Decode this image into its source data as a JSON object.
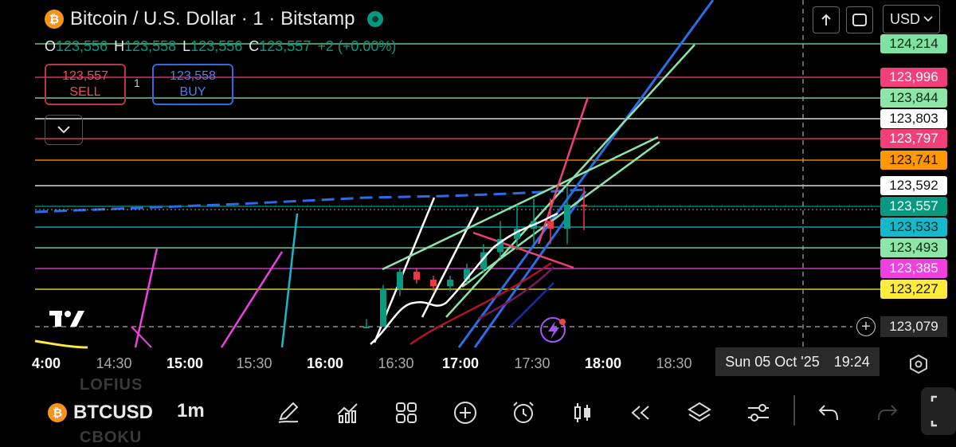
{
  "header": {
    "title": "Bitcoin / U.S. Dollar · 1 · Bitstamp",
    "coin_icon": "bitcoin-icon",
    "coin_glyph": "₿",
    "currency": "USD"
  },
  "ohlc": {
    "o_label": "O",
    "o": "123,556",
    "h_label": "H",
    "h": "123,558",
    "l_label": "L",
    "l": "123,556",
    "c_label": "C",
    "c": "123,557",
    "change": "+2 (+0.00%)"
  },
  "trade": {
    "sell_price": "123,557",
    "sell_label": "SELL",
    "quantity": "1",
    "buy_price": "123,558",
    "buy_label": "BUY"
  },
  "price_scale": {
    "crosshair_price": "123,079",
    "labels": [
      {
        "text": "124,214",
        "bg": "#7ee2a0",
        "fg": "#0b2a14"
      },
      {
        "text": "123,996",
        "bg": "#f23f79",
        "fg": "#ffffff"
      },
      {
        "text": "123,844",
        "bg": "#8de6a8",
        "fg": "#0b2a14"
      },
      {
        "text": "123,803",
        "bg": "#ffffff",
        "fg": "#111111"
      },
      {
        "text": "123,797",
        "bg": "#f23f79",
        "fg": "#ffffff"
      },
      {
        "text": "123,741",
        "bg": "#ff9800",
        "fg": "#111111"
      },
      {
        "text": "123,592",
        "bg": "#ffffff",
        "fg": "#111111"
      },
      {
        "text": "123,557",
        "bg": "#089981",
        "fg": "#ffffff"
      },
      {
        "text": "123,533",
        "bg": "#16b9cc",
        "fg": "#0b2a14"
      },
      {
        "text": "123,493",
        "bg": "#8de6a8",
        "fg": "#0b2a14"
      },
      {
        "text": "123,385",
        "bg": "#f040e0",
        "fg": "#ffffff"
      },
      {
        "text": "123,227",
        "bg": "#ffeb3b",
        "fg": "#111111"
      }
    ]
  },
  "time_axis": {
    "labels": [
      "4:00",
      "14:30",
      "15:00",
      "15:30",
      "16:00",
      "16:30",
      "17:00",
      "17:30",
      "18:00",
      "18:30"
    ],
    "bold": [
      "4:00",
      "15:00",
      "16:00",
      "17:00",
      "18:00"
    ],
    "crosshair_date": "Sun 05 Oct '25",
    "crosshair_time": "19:24"
  },
  "toolbar": {
    "symbol": "BTCUSD",
    "interval": "1m",
    "ghost_top": "LOFIUS",
    "ghost_bottom": "CBOKU",
    "icons": [
      "pencil-icon",
      "indicators-icon",
      "layouts-grid-icon",
      "add-circle-icon",
      "alarm-icon",
      "candles-icon",
      "replay-icon",
      "layers-icon",
      "settings-sliders-icon",
      "undo-icon",
      "redo-icon",
      "fullscreen-icon"
    ]
  },
  "chart_data": {
    "type": "line",
    "title": "Bitcoin / U.S. Dollar · 1 · Bitstamp",
    "xlabel": "",
    "ylabel": "",
    "grid": false,
    "series": [
      {
        "name": "",
        "x": [
          "16:30",
          "16:35",
          "16:40",
          "16:45",
          "16:50",
          "16:55",
          "17:00",
          "17:05",
          "17:10",
          "17:15",
          "17:20",
          "17:25",
          "17:30",
          "17:35"
        ],
        "values": [
          123079,
          123230,
          123360,
          123300,
          123250,
          123300,
          123380,
          123470,
          123510,
          123530,
          123540,
          123530,
          123560,
          123557
        ]
      }
    ],
    "horizontal_levels": [
      124214,
      123996,
      123844,
      123803,
      123797,
      123741,
      123592,
      123557,
      123533,
      123493,
      123385,
      123227
    ]
  }
}
